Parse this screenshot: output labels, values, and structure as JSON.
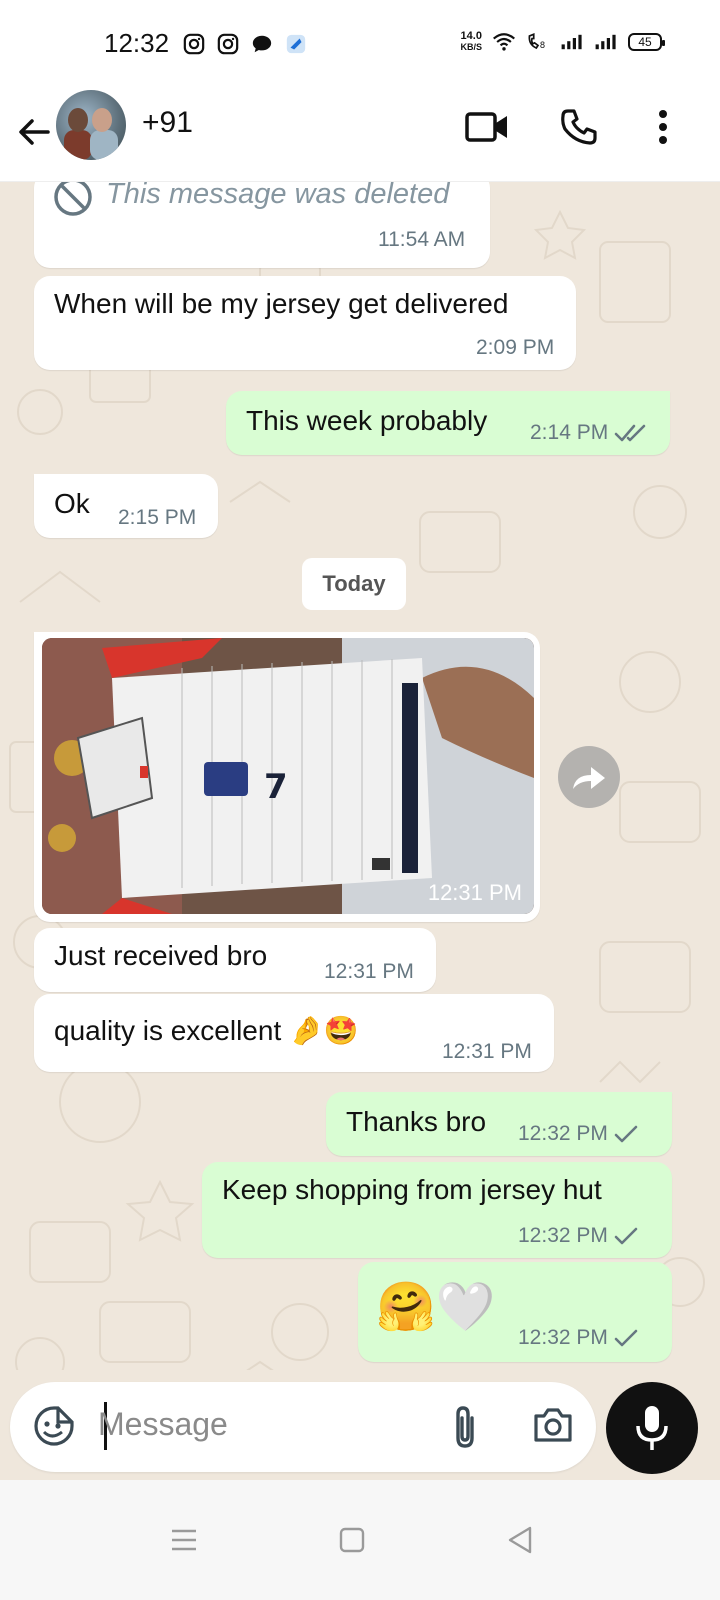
{
  "status_bar": {
    "time": "12:32",
    "net_speed_value": "14.0",
    "net_speed_unit": "KB/S",
    "battery": "45",
    "icons": [
      "instagram-icon",
      "instagram-icon",
      "chat-icon",
      "app-icon",
      "wifi-icon",
      "volte-icon",
      "signal-icon",
      "signal-icon",
      "battery-icon"
    ]
  },
  "header": {
    "contact_name": "+91",
    "icons": [
      "back-arrow-icon",
      "video-call-icon",
      "phone-call-icon",
      "more-vert-icon"
    ]
  },
  "messages": [
    {
      "direction": "in",
      "text": "This message was deleted",
      "time": "11:54 AM",
      "deleted": true
    },
    {
      "direction": "in",
      "text": "When will be my jersey get delivered",
      "time": "2:09 PM"
    },
    {
      "direction": "out",
      "text": "This week probably",
      "time": "2:14 PM",
      "status": "read"
    },
    {
      "direction": "in",
      "text": "Ok",
      "time": "2:15 PM"
    },
    {
      "direction": "date",
      "text": "Today"
    },
    {
      "direction": "in",
      "type": "photo",
      "time": "12:31 PM"
    },
    {
      "direction": "in",
      "text": "Just received bro",
      "time": "12:31 PM"
    },
    {
      "direction": "in",
      "text": "quality is excellent 🤌🤩",
      "time": "12:31 PM"
    },
    {
      "direction": "out",
      "text": "Thanks bro",
      "time": "12:32 PM",
      "status": "sent"
    },
    {
      "direction": "out",
      "text": "Keep shopping from jersey hut",
      "time": "12:32 PM",
      "status": "sent"
    },
    {
      "direction": "out",
      "text": "🤗🤍",
      "time": "12:32 PM",
      "status": "sent"
    }
  ],
  "composer": {
    "placeholder": "Message",
    "icons": [
      "emoji-sticker-icon",
      "attach-icon",
      "camera-icon",
      "mic-icon"
    ]
  },
  "colors": {
    "outgoing_bubble": "#d9fdd3",
    "incoming_bubble": "#ffffff",
    "chat_background": "#efe7dc",
    "read_tick": "#667781"
  }
}
